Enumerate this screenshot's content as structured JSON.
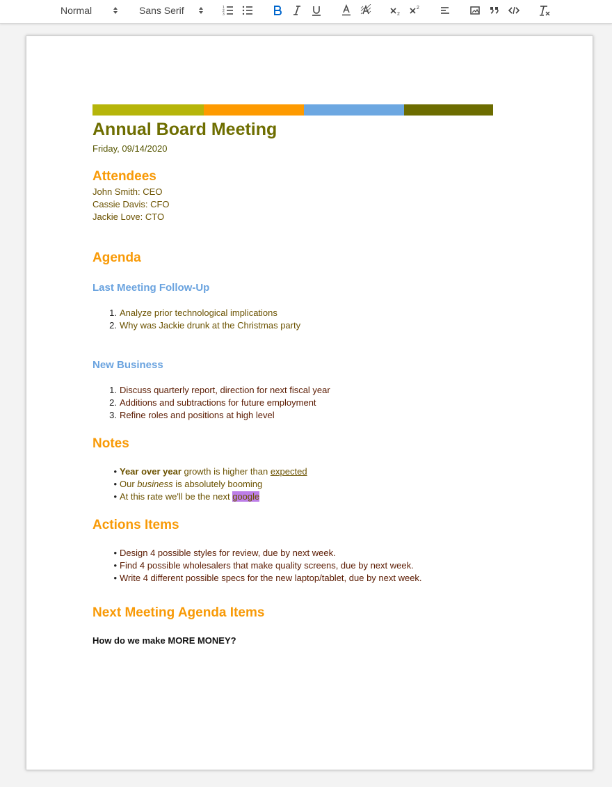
{
  "toolbar": {
    "header_picker": "Normal",
    "font_picker": "Sans Serif",
    "buttons": [
      "ordered-list",
      "bullet-list",
      "bold",
      "italic",
      "underline",
      "text-color",
      "background-color",
      "subscript",
      "superscript",
      "align",
      "image",
      "blockquote",
      "code-block",
      "clean"
    ],
    "accent_color": "#06c"
  },
  "doc": {
    "colorbar": [
      "#b6b50a",
      "#fe9a00",
      "#6ca7e1",
      "#6c6c00"
    ],
    "title": "Annual Board Meeting",
    "date": "Friday, 09/14/2020",
    "attendees_heading": "Attendees",
    "attendees": [
      "John Smith: CEO",
      "Cassie Davis: CFO",
      "Jackie Love: CTO"
    ],
    "agenda_heading": "Agenda",
    "followup_heading": "Last Meeting Follow-Up",
    "followup_items": [
      "Analyze prior technological implications",
      "Why was Jackie drunk at the Christmas party"
    ],
    "newbiz_heading": "New Business",
    "newbiz_items": [
      "Discuss quarterly report, direction for next fiscal year",
      "Additions and subtractions for future employment",
      "Refine roles and positions at high level"
    ],
    "notes_heading": "Notes",
    "notes": {
      "n1_bold": "Year over year",
      "n1_mid": " growth is higher than ",
      "n1_underline": "expected",
      "n2_pre": "Our ",
      "n2_italic": "business",
      "n2_post": " is absolutely booming",
      "n3_pre": "At this rate we'll be the next ",
      "n3_highlight": "google"
    },
    "actions_heading": "Actions Items",
    "actions": [
      "Design 4 possible styles for review, due by next week.",
      "Find 4 possible wholesalers that make quality screens, due by next week.",
      "Write 4 different possible specs for the new laptop/tablet, due by next week."
    ],
    "next_heading": "Next Meeting Agenda Items",
    "next_question": "How do we make MORE MONEY?",
    "list_markers": {
      "n1": "1.",
      "n2": "2.",
      "n3": "3.",
      "bullet": "•"
    }
  }
}
